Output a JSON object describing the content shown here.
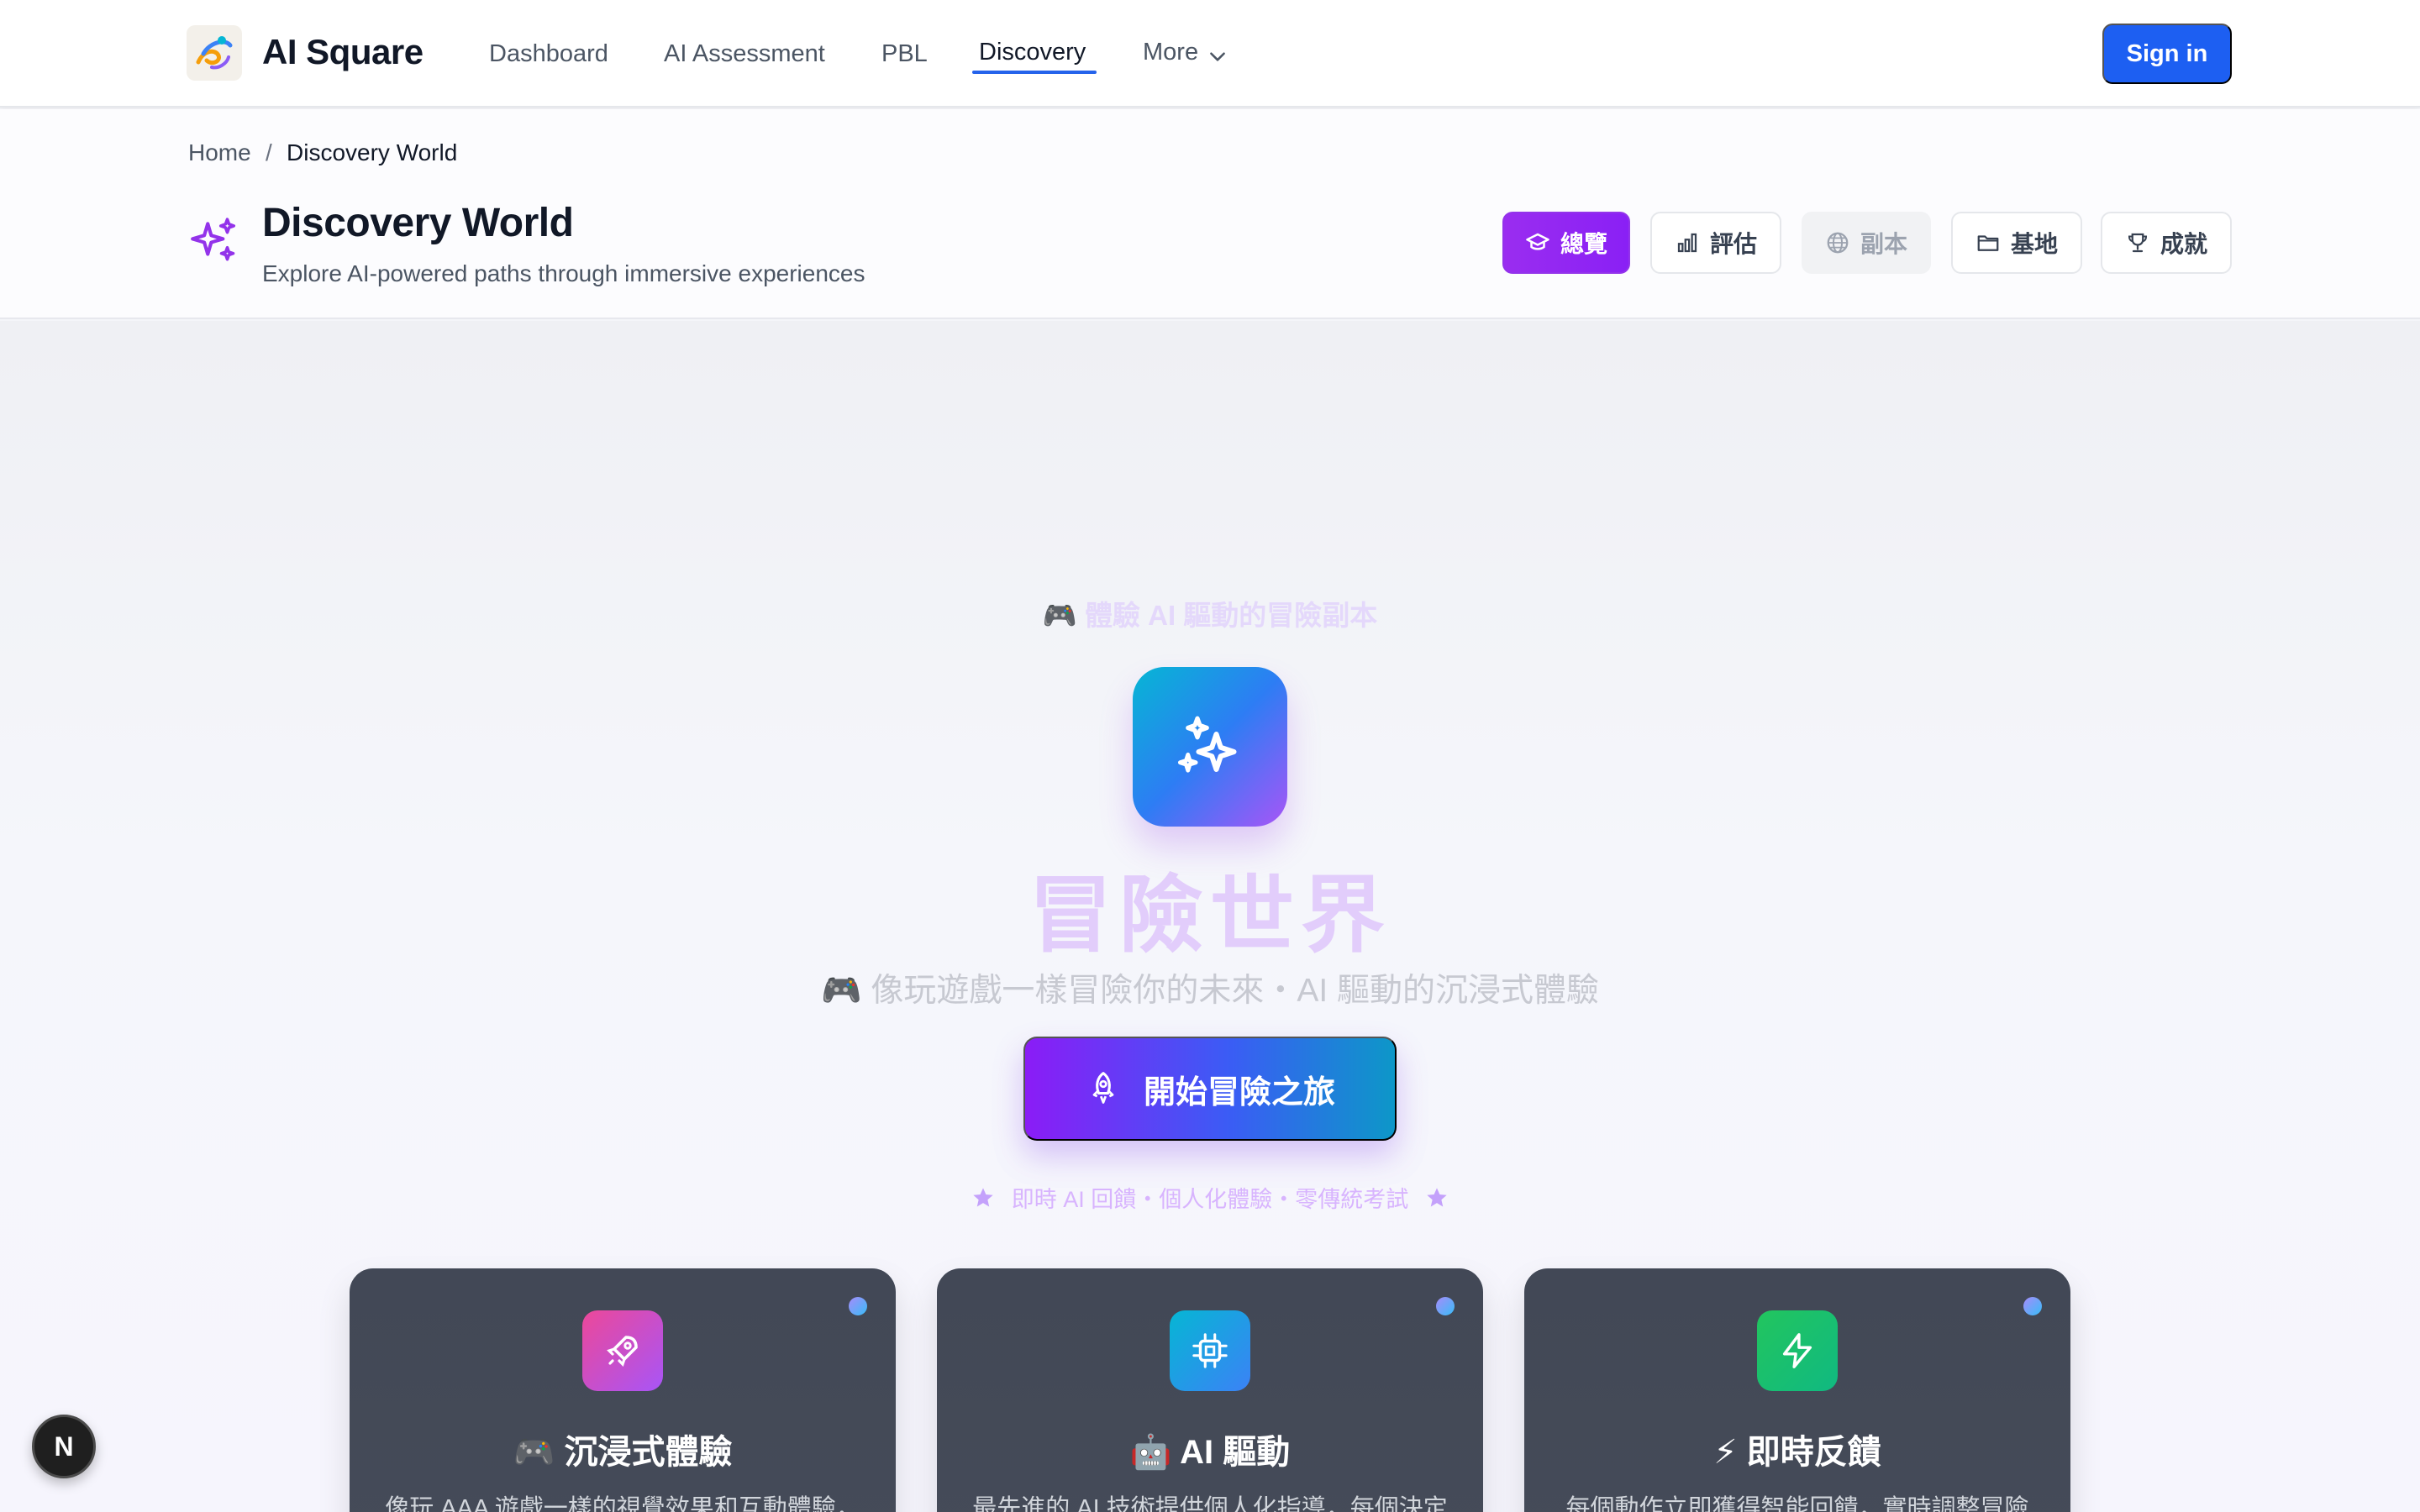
{
  "nav": {
    "brand": "AI Square",
    "links": [
      {
        "label": "Dashboard",
        "active": false
      },
      {
        "label": "AI Assessment",
        "active": false
      },
      {
        "label": "PBL",
        "active": false
      },
      {
        "label": "Discovery",
        "active": true
      },
      {
        "label": "More",
        "active": false
      }
    ],
    "signin_label": "Sign in",
    "accent_color": "#2563eb"
  },
  "breadcrumb": {
    "home": "Home",
    "separator": "/",
    "current": "Discovery World"
  },
  "header": {
    "icon": "sparkles-icon",
    "title": "Discovery World",
    "subtitle": "Explore AI-powered paths through immersive experiences"
  },
  "tabs": [
    {
      "label": "總覽",
      "icon": "graduation-cap-icon",
      "state": "active"
    },
    {
      "label": "評估",
      "icon": "bar-chart-icon",
      "state": "normal"
    },
    {
      "label": "副本",
      "icon": "globe-icon",
      "state": "disabled"
    },
    {
      "label": "基地",
      "icon": "folder-icon",
      "state": "normal"
    },
    {
      "label": "成就",
      "icon": "trophy-icon",
      "state": "normal"
    }
  ],
  "hero": {
    "pre_title": "🎮 體驗 AI 驅動的冒險副本",
    "title": "冒險世界",
    "subtitle": "🎮 像玩遊戲一樣冒險你的未來・AI 驅動的沉浸式體驗",
    "cta_label": "開始冒險之旅",
    "tagline": "即時 AI 回饋・個人化體驗・零傳統考試"
  },
  "features": [
    {
      "title": "🎮 沉浸式體驗",
      "desc": "像玩 AAA 遊戲一樣的視覺效果和互動體驗，",
      "icon": "rocket-icon",
      "color": "#d946ef"
    },
    {
      "title": "🤖 AI 驅動",
      "desc": "最先進的 AI 技術提供個人化指導，每個決定",
      "icon": "cpu-icon",
      "color": "#0ea5e9"
    },
    {
      "title": "⚡ 即時反饋",
      "desc": "每個動作立即獲得智能回饋，實時調整冒險",
      "icon": "lightning-icon",
      "color": "#22c55e"
    }
  ],
  "badge": {
    "letter": "N"
  }
}
